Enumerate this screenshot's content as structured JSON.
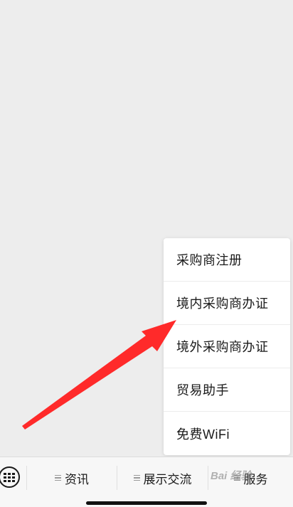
{
  "popup_menu": {
    "items": [
      {
        "label": "采购商注册"
      },
      {
        "label": "境内采购商办证"
      },
      {
        "label": "境外采购商办证"
      },
      {
        "label": "贸易助手"
      },
      {
        "label": "免费WiFi"
      }
    ]
  },
  "bottom_bar": {
    "keyboard_icon": "keyboard-icon",
    "tabs": [
      {
        "label": "资讯",
        "icon": "menu-lines-icon"
      },
      {
        "label": "展示交流",
        "icon": "menu-lines-icon"
      },
      {
        "label": "服务",
        "icon": "menu-lines-icon"
      }
    ]
  },
  "annotation": {
    "arrow_color": "#ff2a2a",
    "watermark": "Bai 经验"
  }
}
